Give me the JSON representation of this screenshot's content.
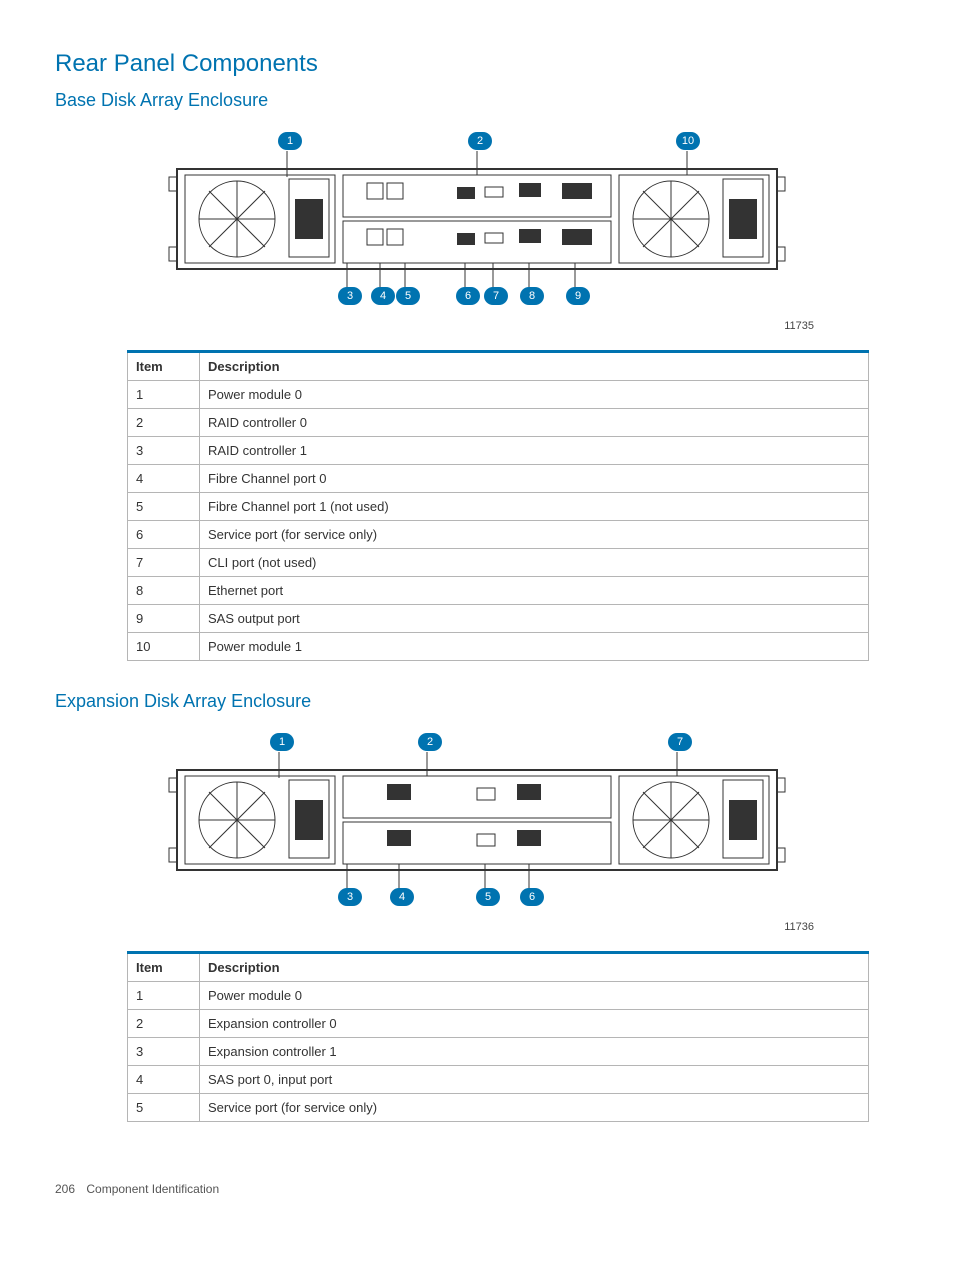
{
  "headings": {
    "section": "Rear Panel Components",
    "sub1": "Base Disk Array Enclosure",
    "sub2": "Expansion Disk Array Enclosure"
  },
  "figures": {
    "fig1_id": "11735",
    "fig2_id": "11736"
  },
  "callouts": {
    "fig1": [
      "1",
      "2",
      "3",
      "4",
      "5",
      "6",
      "7",
      "8",
      "9",
      "10"
    ],
    "fig2": [
      "1",
      "2",
      "3",
      "4",
      "5",
      "6",
      "7"
    ]
  },
  "tables": {
    "headers": {
      "item": "Item",
      "desc": "Description"
    },
    "t1": [
      {
        "item": "1",
        "desc": "Power module 0"
      },
      {
        "item": "2",
        "desc": "RAID controller 0"
      },
      {
        "item": "3",
        "desc": "RAID controller 1"
      },
      {
        "item": "4",
        "desc": "Fibre Channel port 0"
      },
      {
        "item": "5",
        "desc": "Fibre Channel port 1 (not used)"
      },
      {
        "item": "6",
        "desc": "Service port (for service only)"
      },
      {
        "item": "7",
        "desc": "CLI port (not used)"
      },
      {
        "item": "8",
        "desc": "Ethernet port"
      },
      {
        "item": "9",
        "desc": "SAS output port"
      },
      {
        "item": "10",
        "desc": "Power module 1"
      }
    ],
    "t2": [
      {
        "item": "1",
        "desc": "Power module 0"
      },
      {
        "item": "2",
        "desc": "Expansion controller 0"
      },
      {
        "item": "3",
        "desc": "Expansion controller 1"
      },
      {
        "item": "4",
        "desc": "SAS port 0, input port"
      },
      {
        "item": "5",
        "desc": "Service port (for service only)"
      }
    ]
  },
  "footer": {
    "page": "206",
    "title": "Component Identification"
  }
}
